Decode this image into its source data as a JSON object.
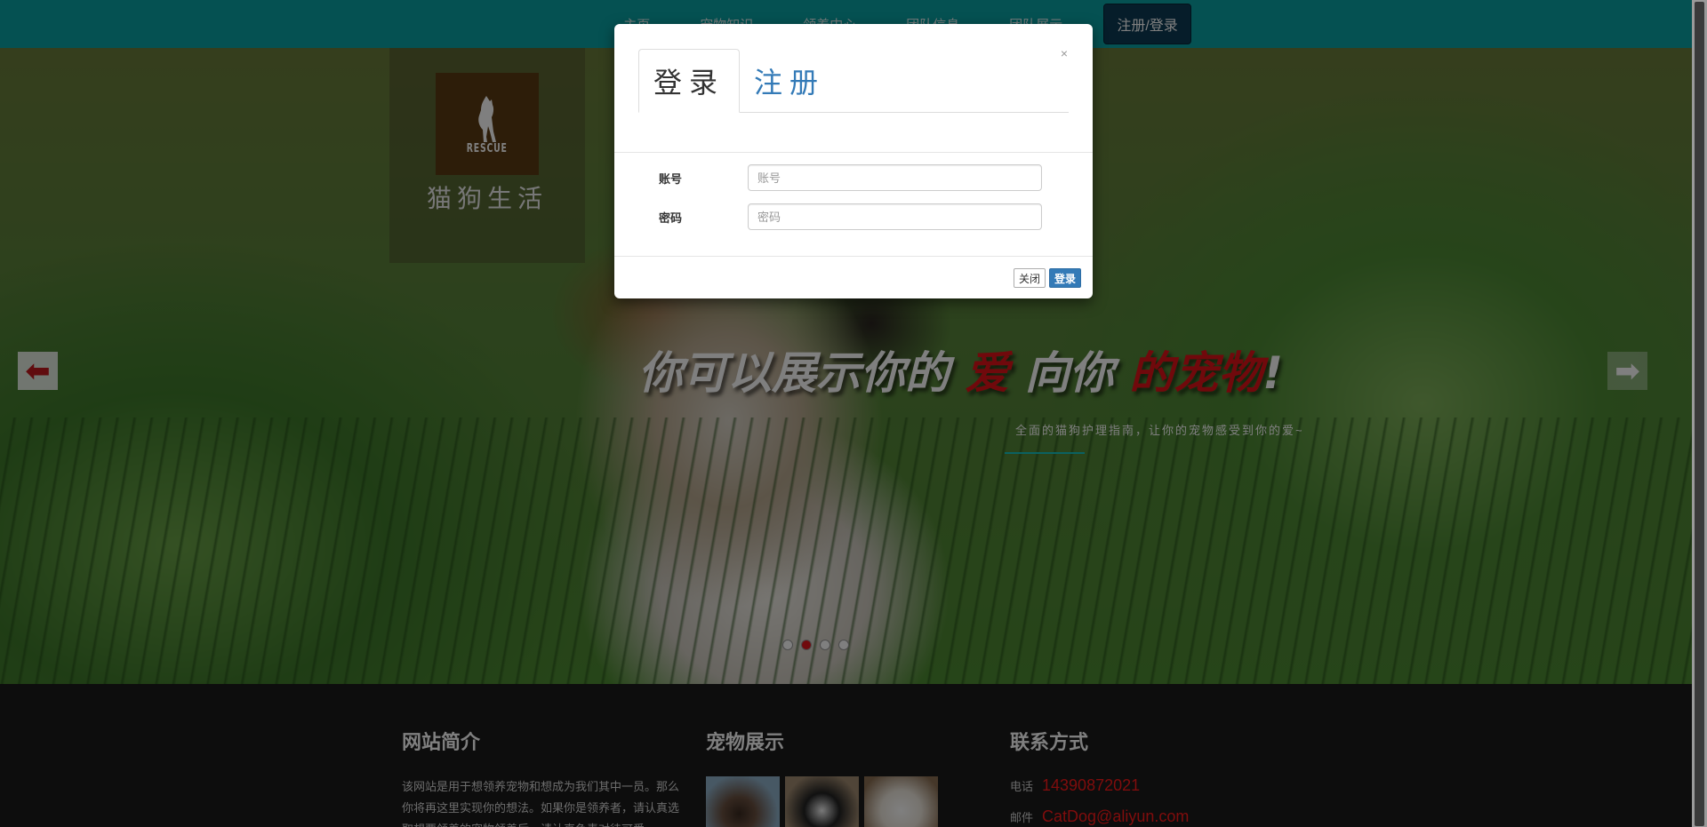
{
  "nav": {
    "items": [
      "主页",
      "宠物知识",
      "领养中心",
      "团队信息",
      "团队展示"
    ],
    "cta": "注册/登录"
  },
  "hero": {
    "logo_text": "RESCUE",
    "site_name": "猫狗生活",
    "headline": {
      "part1": "你可以展示你的",
      "part2": "爱",
      "part3": "向你",
      "part4": "的宠物",
      "part5": "!"
    },
    "subline": "全面的猫狗护理指南，让你的宠物感受到你的爱~",
    "slide_count": 4,
    "active_slide": 2
  },
  "footer": {
    "intro": {
      "title": "网站简介",
      "text": "该网站是用于想领养宠物和想成为我们其中一员。那么你将再这里实现你的想法。如果你是领养者，请认真选取想要领养的宠物领养后，请认真负责对待可爱"
    },
    "gallery": {
      "title": "宠物展示"
    },
    "contact": {
      "title": "联系方式",
      "phone_label": "电话",
      "phone": "14390872021",
      "email_label": "邮件",
      "email": "CatDog@aliyun.com"
    }
  },
  "modal": {
    "close": "×",
    "tab_login": "登录",
    "tab_register": "注册",
    "account_label": "账号",
    "account_placeholder": "账号",
    "password_label": "密码",
    "password_placeholder": "密码",
    "btn_close": "关闭",
    "btn_login": "登录"
  },
  "colors": {
    "nav_bg": "#0ba3a5",
    "accent_red": "#e11219",
    "primary_blue": "#337ab7"
  }
}
